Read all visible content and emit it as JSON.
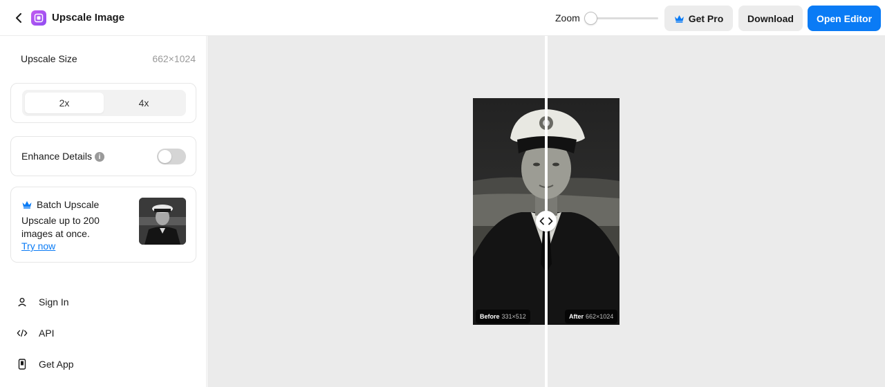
{
  "header": {
    "app_title": "Upscale Image",
    "zoom_label": "Zoom",
    "zoom_level": 0,
    "buttons": {
      "get_pro": "Get Pro",
      "download": "Download",
      "open_editor": "Open Editor"
    }
  },
  "sidebar": {
    "upscale_size_label": "Upscale Size",
    "upscale_size_value": "662×1024",
    "scale_options": [
      {
        "label": "2x",
        "selected": true
      },
      {
        "label": "4x",
        "selected": false
      }
    ],
    "enhance": {
      "label": "Enhance Details",
      "info_glyph": "i",
      "enabled": false
    },
    "batch": {
      "title": "Batch Upscale",
      "description": "Upscale up to 200 images at once.",
      "link": "Try now"
    },
    "nav": [
      {
        "label": "Sign In",
        "icon": "user-icon"
      },
      {
        "label": "API",
        "icon": "code-icon"
      },
      {
        "label": "Get App",
        "icon": "phone-icon"
      }
    ]
  },
  "canvas": {
    "before_label": "Before",
    "before_dims": "331×512",
    "after_label": "After",
    "after_dims": "662×1024"
  },
  "colors": {
    "accent": "#0a7bf5",
    "logo_gradient_start": "#c35cf0",
    "logo_gradient_end": "#8f4cf2",
    "crown": "#0a7bf5",
    "canvas_bg": "#ebebeb"
  }
}
